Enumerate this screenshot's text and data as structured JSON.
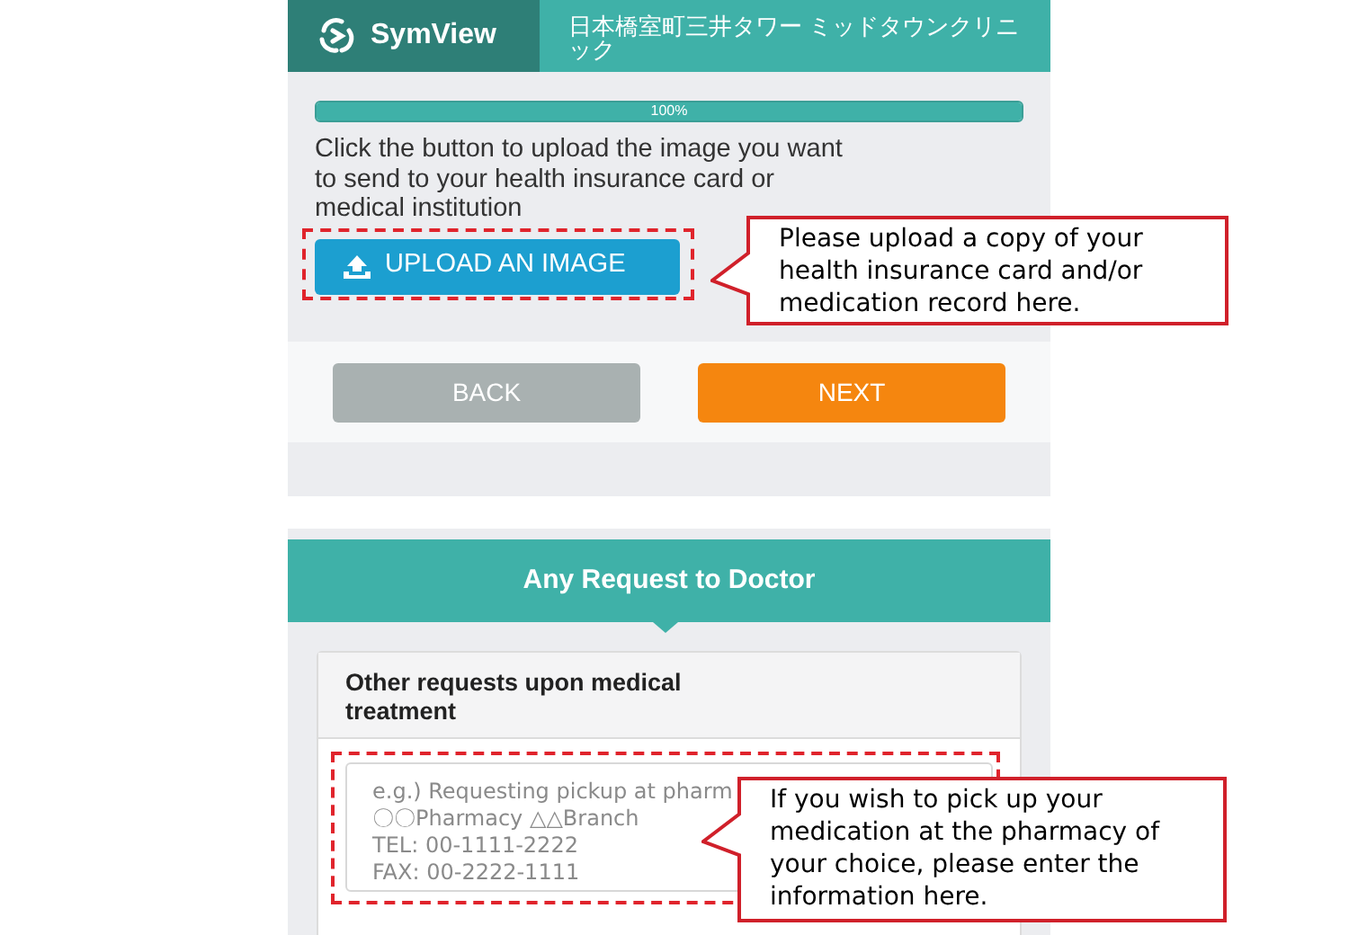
{
  "header": {
    "logo": "SymView",
    "clinic": "日本橋室町三井タワー ミッドタウンクリニック"
  },
  "progress": {
    "level": 1,
    "label": "100%"
  },
  "instructions": "Click the button to upload the image you want to send to your health insurance card or medical institution",
  "upload_button": "UPLOAD AN IMAGE",
  "upload_callout": "Please upload a copy of your health insurance card and/or medication record here.",
  "nav_buttons": [
    {
      "label": "BACK",
      "kind": "secondary"
    },
    {
      "label": "NEXT",
      "kind": "primary"
    }
  ],
  "request_section": {
    "title": "Any Request to Doctor",
    "card_title": "Other requests upon medical treatment",
    "placeholder_lines": [
      "e.g.) Requesting pickup at pharm",
      "〇〇Pharmacy △△Branch",
      "TEL: 00-1111-2222",
      "FAX: 00-2222-1111"
    ],
    "callout": "If you wish to pick up your medication at the pharmacy of your choice, please enter the  information here."
  }
}
